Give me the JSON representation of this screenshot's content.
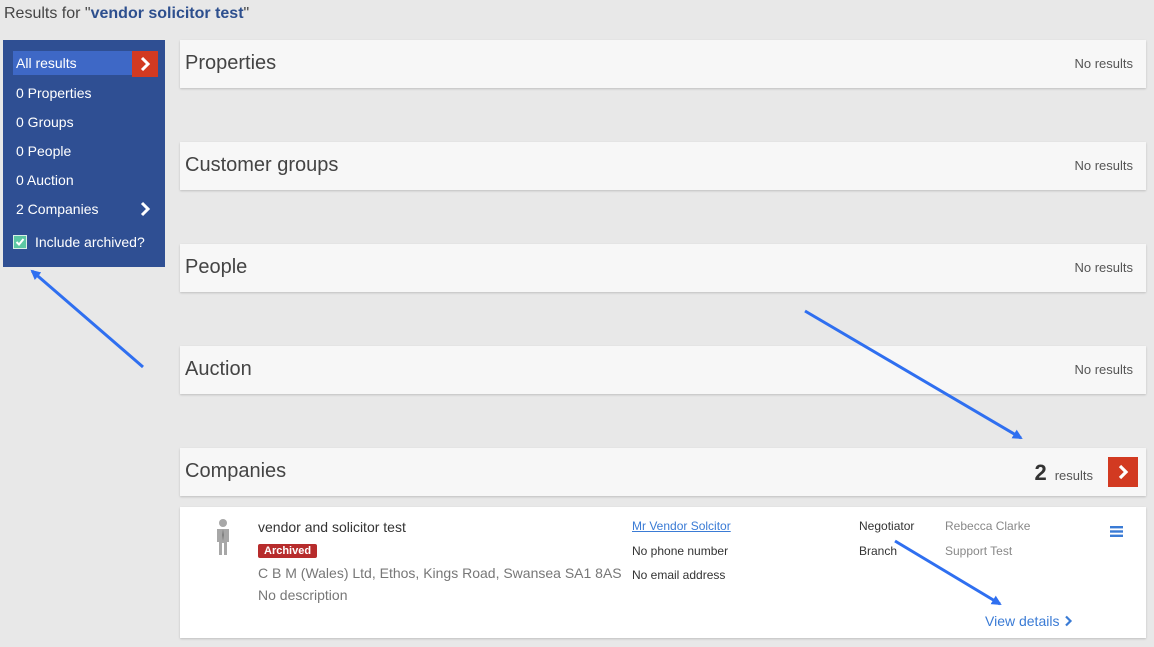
{
  "header": {
    "prefix": "Results for \"",
    "query": "vendor solicitor test",
    "suffix": "\""
  },
  "sidebar": {
    "items": [
      {
        "label": "All results"
      },
      {
        "label": "0 Properties"
      },
      {
        "label": "0 Groups"
      },
      {
        "label": "0 People"
      },
      {
        "label": "0 Auction"
      },
      {
        "label": "2 Companies"
      }
    ],
    "include_archived_label": "Include archived?",
    "include_archived_checked": true
  },
  "sections": [
    {
      "title": "Properties",
      "status": "No results"
    },
    {
      "title": "Customer groups",
      "status": "No results"
    },
    {
      "title": "People",
      "status": "No results"
    },
    {
      "title": "Auction",
      "status": "No results"
    },
    {
      "title": "Companies",
      "count": "2",
      "count_label": "results"
    }
  ],
  "result": {
    "name": "vendor and solicitor test",
    "badge": "Archived",
    "address": "C B M (Wales) Ltd, Ethos, Kings Road, Swansea SA1 8AS",
    "description": "No description",
    "contact_name": "Mr Vendor Solcitor",
    "phone": "No phone number",
    "email": "No email address",
    "negotiator_label": "Negotiator",
    "negotiator": "Rebecca Clarke",
    "branch_label": "Branch",
    "branch": "Support Test",
    "view_details": "View details"
  },
  "colors": {
    "sidebar_bg": "#2f4f93",
    "sidebar_active": "#3e68c6",
    "accent_red": "#d23a21",
    "badge_red": "#b72c2c",
    "link_blue": "#3a7bd5",
    "annotation_arrow": "#2f6ff0"
  },
  "icons": [
    "chevron-right-icon",
    "checkmark-icon",
    "person-icon",
    "hamburger-menu-icon"
  ]
}
